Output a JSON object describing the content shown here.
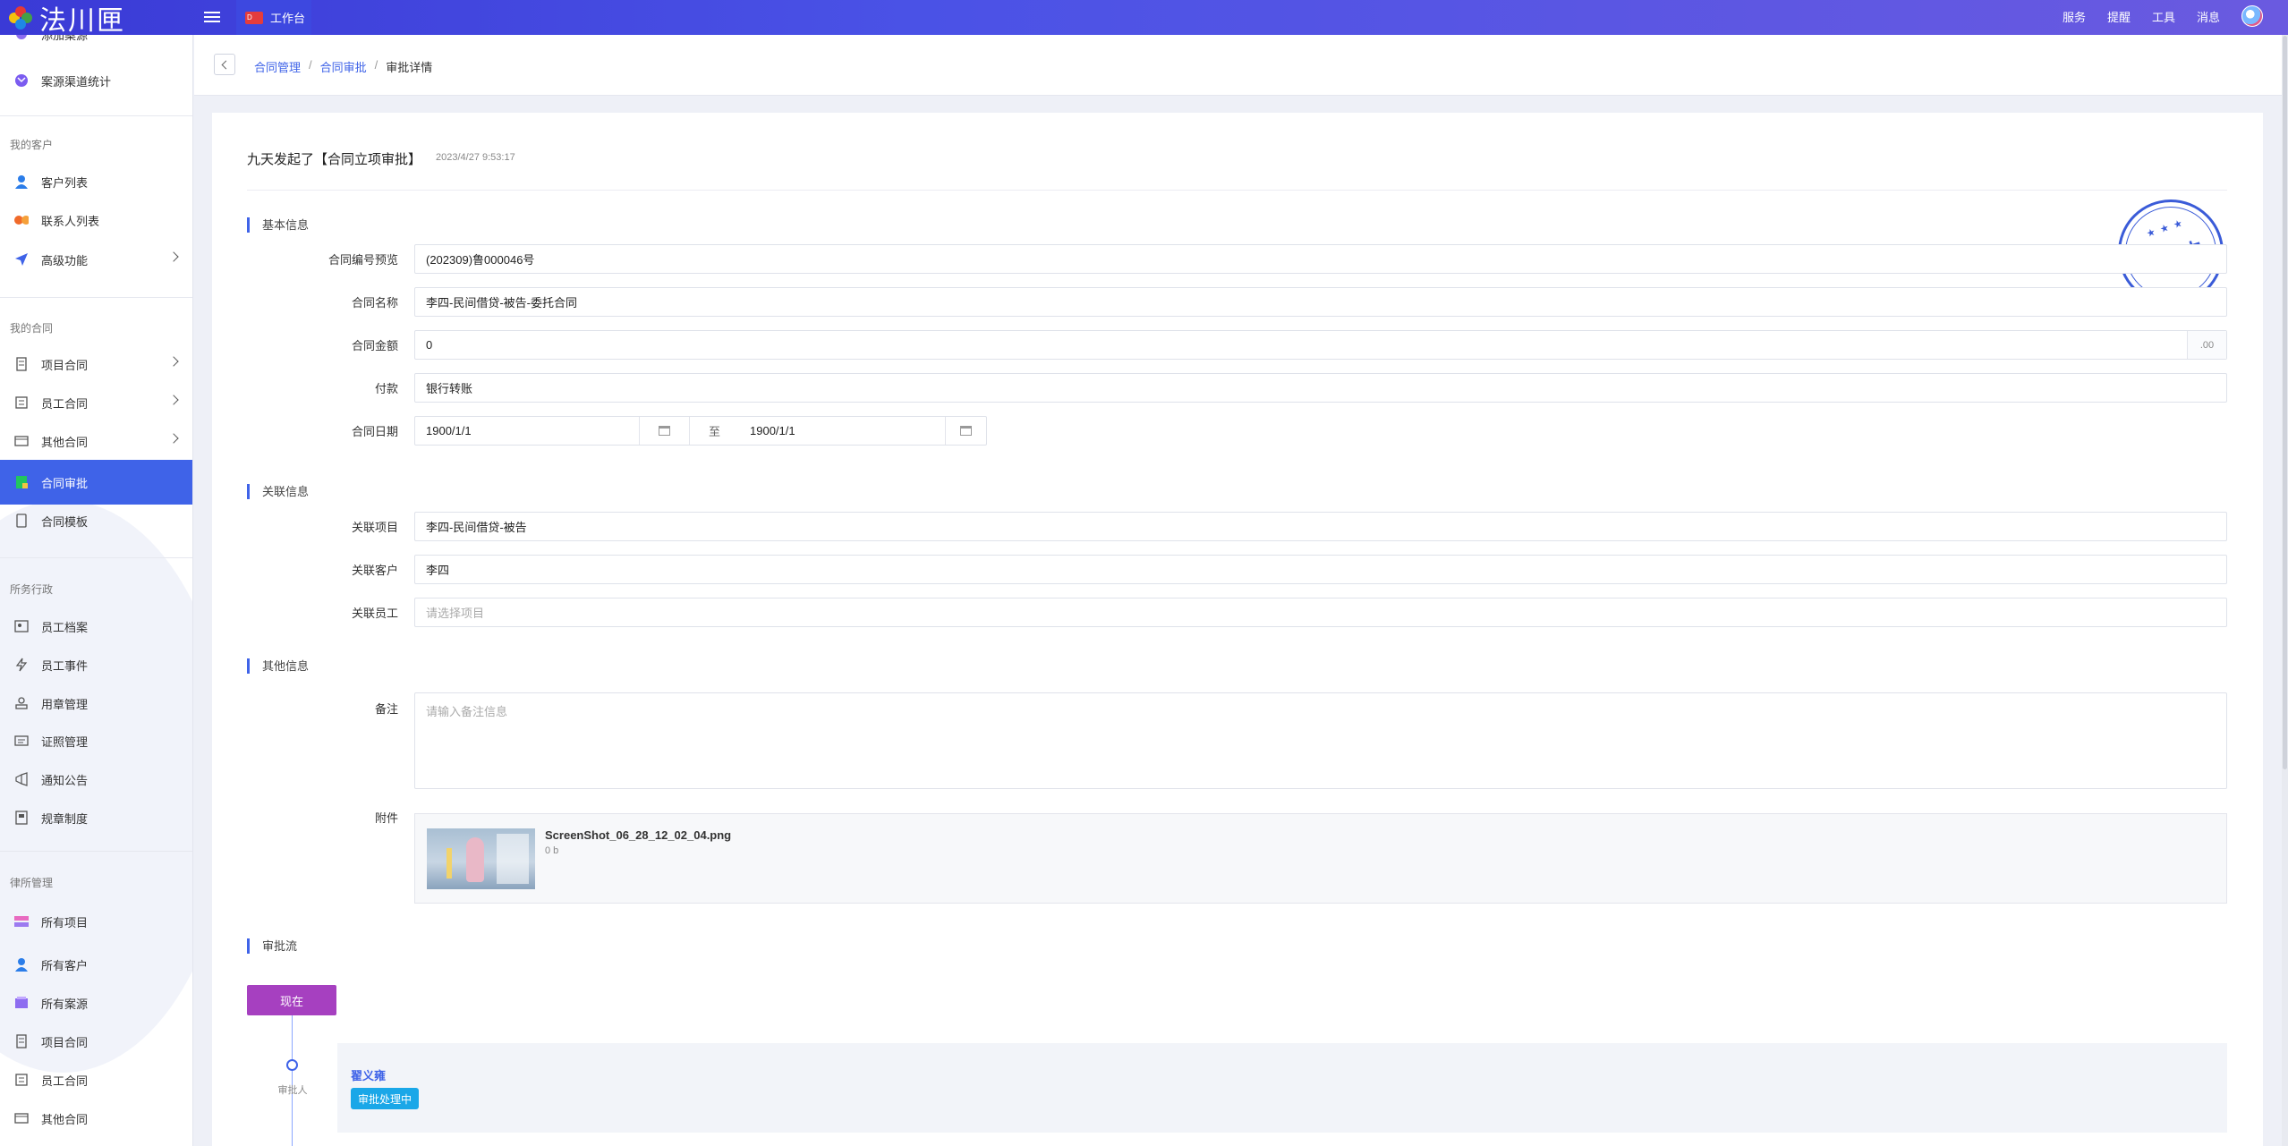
{
  "app": {
    "logo_text": "法川匣",
    "tab_label": "工作台",
    "tab_icon_text": "D"
  },
  "top_nav": [
    "服务",
    "提醒",
    "工具",
    "消息"
  ],
  "sidebar": {
    "items_top": [
      {
        "label": "添加案源",
        "icon": "add-source-icon"
      },
      {
        "label": "案源渠道统计",
        "icon": "source-stats-icon"
      }
    ],
    "sections": [
      {
        "title": "我的客户",
        "items": [
          {
            "label": "客户列表",
            "icon": "user-icon"
          },
          {
            "label": "联系人列表",
            "icon": "contacts-icon"
          },
          {
            "label": "高级功能",
            "icon": "send-icon"
          }
        ]
      },
      {
        "title": "我的合同",
        "items": [
          {
            "label": "项目合同",
            "icon": "contract-icon"
          },
          {
            "label": "员工合同",
            "icon": "contract-icon"
          },
          {
            "label": "其他合同",
            "icon": "contract-icon"
          },
          {
            "label": "合同审批",
            "icon": "approval-icon"
          },
          {
            "label": "合同模板",
            "icon": "template-icon"
          }
        ]
      },
      {
        "title": "所务行政",
        "items": [
          {
            "label": "员工档案",
            "icon": "profile-icon"
          },
          {
            "label": "员工事件",
            "icon": "event-icon"
          },
          {
            "label": "用章管理",
            "icon": "seal-icon"
          },
          {
            "label": "证照管理",
            "icon": "license-icon"
          },
          {
            "label": "通知公告",
            "icon": "notice-icon"
          },
          {
            "label": "规章制度",
            "icon": "rules-icon"
          }
        ]
      },
      {
        "title": "律所管理",
        "items": [
          {
            "label": "所有项目",
            "icon": "projects-icon"
          },
          {
            "label": "所有客户",
            "icon": "user-icon"
          },
          {
            "label": "所有案源",
            "icon": "source-icon"
          },
          {
            "label": "项目合同",
            "icon": "contract-icon"
          },
          {
            "label": "员工合同",
            "icon": "contract-icon"
          },
          {
            "label": "其他合同",
            "icon": "contract-icon"
          }
        ]
      }
    ]
  },
  "breadcrumb": {
    "items": [
      "合同管理",
      "合同审批"
    ],
    "current": "审批详情",
    "sep": "/"
  },
  "header": {
    "title": "九天发起了【合同立项审批】",
    "time": "2023/4/27 9:53:17"
  },
  "basic": {
    "title": "基本信息",
    "contract_no_label": "合同编号预览",
    "contract_no": "(202309)鲁000046号",
    "name_label": "合同名称",
    "name": "李四-民间借贷-被告-委托合同",
    "amount_label": "合同金额",
    "amount": "0",
    "amount_suffix": ".00",
    "payment_label": "付款",
    "payment": "银行转账",
    "date_label": "合同日期",
    "date_from": "1900/1/1",
    "date_to_label": "至",
    "date_to": "1900/1/1"
  },
  "related": {
    "title": "关联信息",
    "project_label": "关联项目",
    "project": "李四-民间借贷-被告",
    "customer_label": "关联客户",
    "customer": "李四",
    "employee_label": "关联员工",
    "employee_placeholder": "请选择项目"
  },
  "other": {
    "title": "其他信息",
    "remark_label": "备注",
    "remark_placeholder": "请输入备注信息",
    "attach_label": "附件",
    "file_name": "ScreenShot_06_28_12_02_04.png",
    "file_size": "0 b"
  },
  "stamp": {
    "text": "审批中",
    "stars": "★★★"
  },
  "flow": {
    "title": "审批流",
    "now": "现在",
    "role": "审批人",
    "approver": "翟义雍",
    "status": "审批处理中"
  },
  "colors": {
    "accent": "#3f63e8",
    "now_button": "#a640c0",
    "status_badge": "#1aa7e8"
  }
}
